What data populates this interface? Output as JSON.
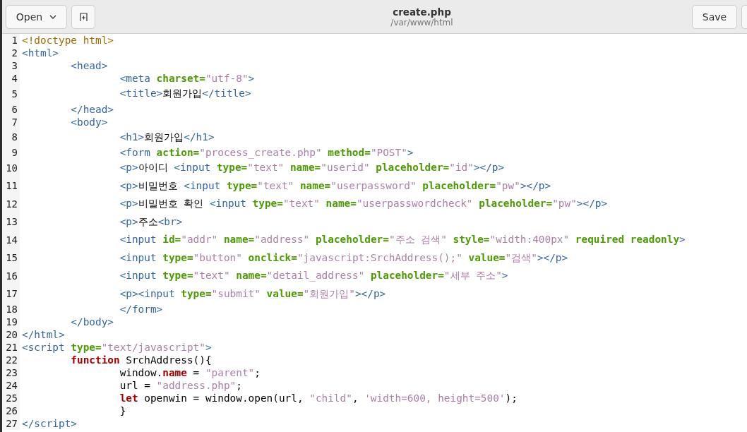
{
  "header": {
    "open_button": "Open",
    "title": "create.php",
    "subtitle": "/var/www/html",
    "save_button": "Save"
  },
  "editor": {
    "lines": [
      {
        "number": "1",
        "tokens": [
          {
            "kind": "doctype",
            "text": "<!doctype html>"
          }
        ]
      },
      {
        "number": "2",
        "tokens": [
          {
            "kind": "tag",
            "text": "<html>"
          }
        ]
      },
      {
        "number": "3",
        "tokens": [
          {
            "kind": "tag",
            "text": "\t<head>"
          }
        ]
      },
      {
        "number": "4",
        "tokens": [
          {
            "kind": "tag",
            "text": "\t\t<meta "
          },
          {
            "kind": "attr",
            "text": "charset="
          },
          {
            "kind": "string",
            "text": "\"utf-8\""
          },
          {
            "kind": "tag",
            "text": ">"
          }
        ]
      },
      {
        "number": "5",
        "tokens": [
          {
            "kind": "tag",
            "text": "\t\t<title>"
          },
          {
            "kind": "plain",
            "text": "회원가입"
          },
          {
            "kind": "tag",
            "text": "</title>"
          }
        ]
      },
      {
        "number": "6",
        "tokens": [
          {
            "kind": "tag",
            "text": "\t</head>"
          }
        ]
      },
      {
        "number": "7",
        "tokens": [
          {
            "kind": "tag",
            "text": "\t<body>"
          }
        ]
      },
      {
        "number": "8",
        "tokens": [
          {
            "kind": "tag",
            "text": "\t\t<h1>"
          },
          {
            "kind": "plain",
            "text": "회원가입"
          },
          {
            "kind": "tag",
            "text": "</h1>"
          }
        ]
      },
      {
        "number": "9",
        "tokens": [
          {
            "kind": "tag",
            "text": "\t\t<form "
          },
          {
            "kind": "attr",
            "text": "action="
          },
          {
            "kind": "string",
            "text": "\"process_create.php\" "
          },
          {
            "kind": "attr",
            "text": "method="
          },
          {
            "kind": "string",
            "text": "\"POST\""
          },
          {
            "kind": "tag",
            "text": ">"
          }
        ]
      },
      {
        "number": "10",
        "tokens": [
          {
            "kind": "tag",
            "text": "\t\t<p>"
          },
          {
            "kind": "plain",
            "text": "아이디 "
          },
          {
            "kind": "tag",
            "text": "<input "
          },
          {
            "kind": "attr",
            "text": "type="
          },
          {
            "kind": "string",
            "text": "\"text\" "
          },
          {
            "kind": "attr",
            "text": "name="
          },
          {
            "kind": "string",
            "text": "\"userid\" "
          },
          {
            "kind": "attr",
            "text": "placeholder="
          },
          {
            "kind": "string",
            "text": "\"id\""
          },
          {
            "kind": "tag",
            "text": "></p>"
          }
        ]
      },
      {
        "number": "11",
        "tokens": [
          {
            "kind": "tag",
            "text": "\t\t<p>"
          },
          {
            "kind": "plain",
            "text": "비밀번호 "
          },
          {
            "kind": "tag",
            "text": "<input "
          },
          {
            "kind": "attr",
            "text": "type="
          },
          {
            "kind": "string",
            "text": "\"text\" "
          },
          {
            "kind": "attr",
            "text": "name="
          },
          {
            "kind": "string",
            "text": "\"userpassword\" "
          },
          {
            "kind": "attr",
            "text": "placeholder="
          },
          {
            "kind": "string",
            "text": "\"pw\""
          },
          {
            "kind": "tag",
            "text": "></p>"
          }
        ]
      },
      {
        "number": "12",
        "tokens": [
          {
            "kind": "tag",
            "text": "\t\t<p>"
          },
          {
            "kind": "plain",
            "text": "비밀번호 확인 "
          },
          {
            "kind": "tag",
            "text": "<input "
          },
          {
            "kind": "attr",
            "text": "type="
          },
          {
            "kind": "string",
            "text": "\"text\" "
          },
          {
            "kind": "attr",
            "text": "name="
          },
          {
            "kind": "string",
            "text": "\"userpasswordcheck\" "
          },
          {
            "kind": "attr",
            "text": "placeholder="
          },
          {
            "kind": "string",
            "text": "\"pw\""
          },
          {
            "kind": "tag",
            "text": "></p>"
          }
        ]
      },
      {
        "number": "13",
        "tokens": [
          {
            "kind": "tag",
            "text": "\t\t<p>"
          },
          {
            "kind": "plain",
            "text": "주소"
          },
          {
            "kind": "tag",
            "text": "<br>"
          }
        ]
      },
      {
        "number": "14",
        "tokens": [
          {
            "kind": "tag",
            "text": "\t\t<input "
          },
          {
            "kind": "attr",
            "text": "id="
          },
          {
            "kind": "string",
            "text": "\"addr\" "
          },
          {
            "kind": "attr",
            "text": "name="
          },
          {
            "kind": "string",
            "text": "\"address\" "
          },
          {
            "kind": "attr",
            "text": "placeholder="
          },
          {
            "kind": "string",
            "text": "\"주소 검색\" "
          },
          {
            "kind": "attr",
            "text": "style="
          },
          {
            "kind": "string",
            "text": "\"width:400px\" "
          },
          {
            "kind": "attr",
            "text": "required readonly"
          },
          {
            "kind": "tag",
            "text": ">"
          }
        ]
      },
      {
        "number": "15",
        "tokens": [
          {
            "kind": "tag",
            "text": "\t\t<input "
          },
          {
            "kind": "attr",
            "text": "type="
          },
          {
            "kind": "string",
            "text": "\"button\" "
          },
          {
            "kind": "attr",
            "text": "onclick="
          },
          {
            "kind": "string",
            "text": "\"javascript:SrchAddress();\" "
          },
          {
            "kind": "attr",
            "text": "value="
          },
          {
            "kind": "string",
            "text": "\"검색\""
          },
          {
            "kind": "tag",
            "text": "></p>"
          }
        ]
      },
      {
        "number": "16",
        "tokens": [
          {
            "kind": "tag",
            "text": "\t\t<input "
          },
          {
            "kind": "attr",
            "text": "type="
          },
          {
            "kind": "string",
            "text": "\"text\" "
          },
          {
            "kind": "attr",
            "text": "name="
          },
          {
            "kind": "string",
            "text": "\"detail_address\" "
          },
          {
            "kind": "attr",
            "text": "placeholder="
          },
          {
            "kind": "string",
            "text": "\"세부 주소\""
          },
          {
            "kind": "tag",
            "text": ">"
          }
        ]
      },
      {
        "number": "17",
        "tokens": [
          {
            "kind": "tag",
            "text": "\t\t<p><input "
          },
          {
            "kind": "attr",
            "text": "type="
          },
          {
            "kind": "string",
            "text": "\"submit\" "
          },
          {
            "kind": "attr",
            "text": "value="
          },
          {
            "kind": "string",
            "text": "\"회원가입\""
          },
          {
            "kind": "tag",
            "text": "></p>"
          }
        ]
      },
      {
        "number": "18",
        "tokens": [
          {
            "kind": "tag",
            "text": "\t\t</form>"
          }
        ]
      },
      {
        "number": "19",
        "tokens": [
          {
            "kind": "tag",
            "text": "\t</body>"
          }
        ]
      },
      {
        "number": "20",
        "tokens": [
          {
            "kind": "tag",
            "text": "</html>"
          }
        ]
      },
      {
        "number": "21",
        "tokens": [
          {
            "kind": "tag",
            "text": "<script "
          },
          {
            "kind": "attr",
            "text": "type="
          },
          {
            "kind": "string",
            "text": "\"text/javascript\""
          },
          {
            "kind": "tag",
            "text": ">"
          }
        ]
      },
      {
        "number": "22",
        "tokens": [
          {
            "kind": "keyword",
            "text": "\tfunction"
          },
          {
            "kind": "plain",
            "text": " SrchAddress(){"
          }
        ]
      },
      {
        "number": "23",
        "tokens": [
          {
            "kind": "plain",
            "text": "\t\twindow."
          },
          {
            "kind": "keyword",
            "text": "name"
          },
          {
            "kind": "plain",
            "text": " = "
          },
          {
            "kind": "string",
            "text": "\"parent\""
          },
          {
            "kind": "plain",
            "text": ";"
          }
        ]
      },
      {
        "number": "24",
        "tokens": [
          {
            "kind": "plain",
            "text": "\t\turl = "
          },
          {
            "kind": "string",
            "text": "\"address.php\""
          },
          {
            "kind": "plain",
            "text": ";"
          }
        ]
      },
      {
        "number": "25",
        "tokens": [
          {
            "kind": "keyword",
            "text": "\t\tlet"
          },
          {
            "kind": "plain",
            "text": " openwin = window.open(url, "
          },
          {
            "kind": "string",
            "text": "\"child\""
          },
          {
            "kind": "plain",
            "text": ", "
          },
          {
            "kind": "string",
            "text": "'width=600, height=500'"
          },
          {
            "kind": "plain",
            "text": ");"
          }
        ]
      },
      {
        "number": "26",
        "tokens": [
          {
            "kind": "plain",
            "text": "\t\t}"
          }
        ]
      },
      {
        "number": "27",
        "tokens": [
          {
            "kind": "tag",
            "text": "</script>"
          }
        ]
      }
    ]
  }
}
